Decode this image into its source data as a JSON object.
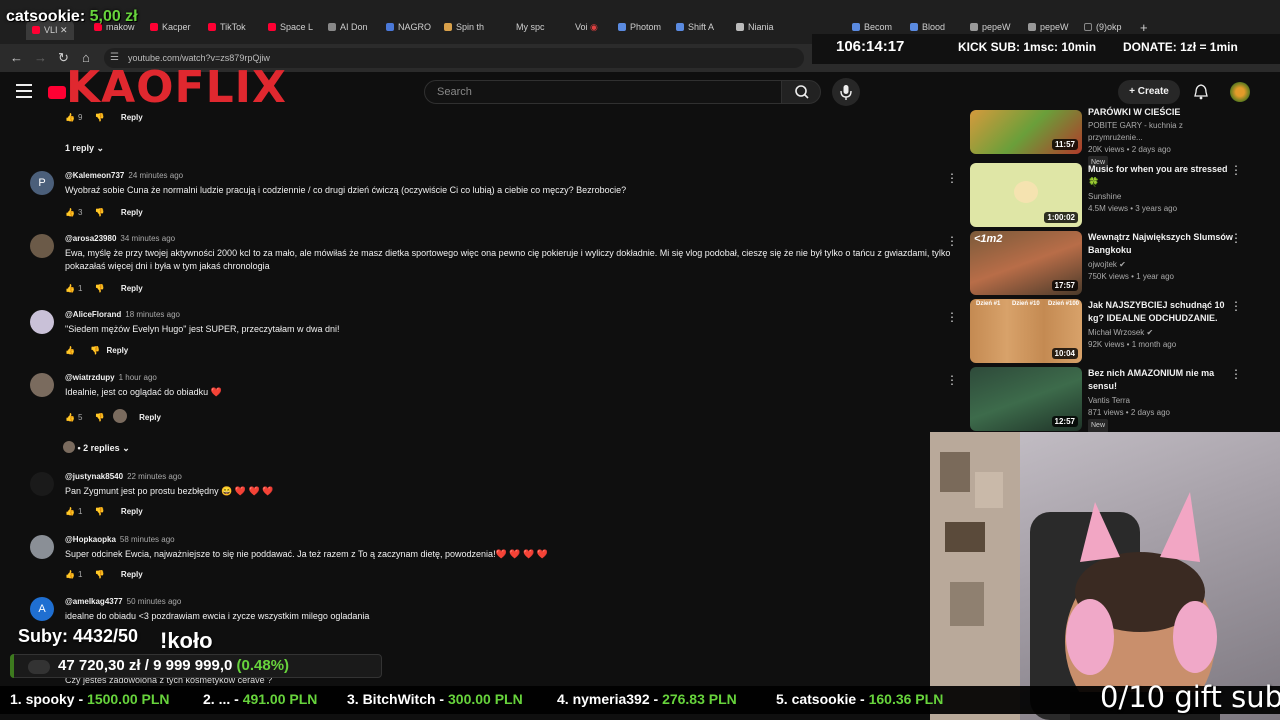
{
  "browser": {
    "tabs": [
      "VLI",
      "makow",
      "Kacper",
      "TikTok",
      "Space L",
      "AI Don",
      "NAGRO",
      "Spin th",
      "My spc",
      "Voi",
      "Photom",
      "Shift A",
      "Niania",
      "Becom",
      "Blood",
      "pepeW",
      "pepeW",
      "(9)okp"
    ],
    "url": "youtube.com/watch?v=zs879rpQjiw"
  },
  "overlay": {
    "top_donation_name": "catsookie:",
    "top_donation_amount": "5,00 zł",
    "timer": "106:14:17",
    "kick_sub": "KICK SUB: 1msc: 10min",
    "donate": "DONATE: 1zł = 1min",
    "brand": "KAOFLIX",
    "subs": "Suby: 4432/50",
    "kolo": "!koło",
    "goal_current": "47 720,30 zł",
    "goal_target": "9 999 999,0",
    "goal_percent": "(0.48%)",
    "goal_fraction": 0.0048,
    "gift_sub": "0/10 gift sub",
    "ticker": [
      {
        "rank": "1. spooky - ",
        "amount": "1500.00 PLN"
      },
      {
        "rank": "2. ... - ",
        "amount": "491.00 PLN"
      },
      {
        "rank": "3. BitchWitch - ",
        "amount": "300.00 PLN"
      },
      {
        "rank": "4. nymeria392 - ",
        "amount": "276.83 PLN"
      },
      {
        "rank": "5. catsookie - ",
        "amount": "160.36 PLN"
      }
    ]
  },
  "header": {
    "search_placeholder": "Search",
    "create_label": "Create"
  },
  "comments": {
    "top_likes": "9",
    "top_reply": "Reply",
    "one_reply": "1 reply",
    "items": [
      {
        "initial": "P",
        "user": "@Kalemeon737",
        "time": "24 minutes ago",
        "text": "Wyobraź sobie Cuna że normalni ludzie pracują i codziennie / co drugi dzień ćwiczą (oczywiście Ci co lubią) a ciebie co męczy? Bezrobocie?",
        "likes": "3",
        "reply": "Reply"
      },
      {
        "initial": "",
        "user": "@arosa23980",
        "time": "34 minutes ago",
        "text": "Ewa, myślę że przy twojej aktywności 2000 kcl to za mało, ale mówiłaś że masz dietka sportowego więc ona pewno cię pokieruje i wyliczy dokładnie. Mi się vlog podobał, cieszę się że nie był tylko o tańcu z gwiazdami, tylko pokazałaś więcej dni i była w tym jakaś chronologia",
        "likes": "1",
        "reply": "Reply"
      },
      {
        "initial": "",
        "user": "@AliceFlorand",
        "time": "18 minutes ago",
        "text": "\"Siedem mężów Evelyn Hugo\" jest SUPER, przeczytałam w dwa dni!",
        "likes": "",
        "reply": "Reply"
      },
      {
        "initial": "",
        "user": "@wiatrzdupy",
        "time": "1 hour ago",
        "text": "Idealnie, jest co oglądać do obiadku ❤️",
        "likes": "5",
        "reply": "Reply",
        "replies_label": "• 2 replies"
      },
      {
        "initial": "",
        "user": "@justynak8540",
        "time": "22 minutes ago",
        "text": "Pan Zygmunt jest po prostu bezbłędny 😄 ❤️ ❤️ ❤️",
        "likes": "1",
        "reply": "Reply"
      },
      {
        "initial": "",
        "user": "@Hopkaopka",
        "time": "58 minutes ago",
        "text": "Super odcinek Ewcia, najważniejsze to się nie poddawać. Ja też razem z To ą zaczynam dietę, powodzenia!❤️ ❤️ ❤️ ❤️",
        "likes": "1",
        "reply": "Reply"
      },
      {
        "initial": "A",
        "user": "@amelkag4377",
        "time": "50 minutes ago",
        "text": "idealne do obiadu <3 pozdrawiam ewcia i zycze wszystkim milego ogladania",
        "likes": "",
        "reply": ""
      }
    ],
    "partial_text": "Czy jesteś zadowolona z tych kosmetyków cerave ?"
  },
  "sidebar": {
    "videos": [
      {
        "title": "PARÓWKI W CIEŚCIE",
        "channel": "POBITE GARY - kuchnia z przymrużenie...",
        "meta": "20K views • 2 days ago",
        "badge": "New",
        "duration": "11:57"
      },
      {
        "title": "Music for when you are stressed 🍀",
        "channel": "Sunshine",
        "meta": "4.5M views • 3 years ago",
        "badge": "",
        "duration": "1:00:02"
      },
      {
        "title": "Wewnątrz Największych Slumsów Bangkoku",
        "channel": "ojwojtek ✔",
        "meta": "750K views • 1 year ago",
        "badge": "",
        "duration": "17:57",
        "thumb_text": "<1m2"
      },
      {
        "title": "Jak NAJSZYBCIEJ schudnąć 10 kg? IDEALNE ODCHUDZANIE.",
        "channel": "Michał Wrzosek ✔",
        "meta": "92K views • 1 month ago",
        "badge": "",
        "duration": "10:04",
        "thumb_labels": [
          "Dzień #1",
          "Dzień #10",
          "Dzień #100"
        ]
      },
      {
        "title": "Bez nich AMAZONIUM nie ma sensu!",
        "channel": "Vantis Terra",
        "meta": "871 views • 2 days ago",
        "badge": "New",
        "duration": "12:57"
      }
    ]
  },
  "colors": {
    "accent_green": "#67d33c",
    "yt_red": "#ff0033",
    "brand_red": "#e0282f",
    "background": "#0f0f0f"
  }
}
